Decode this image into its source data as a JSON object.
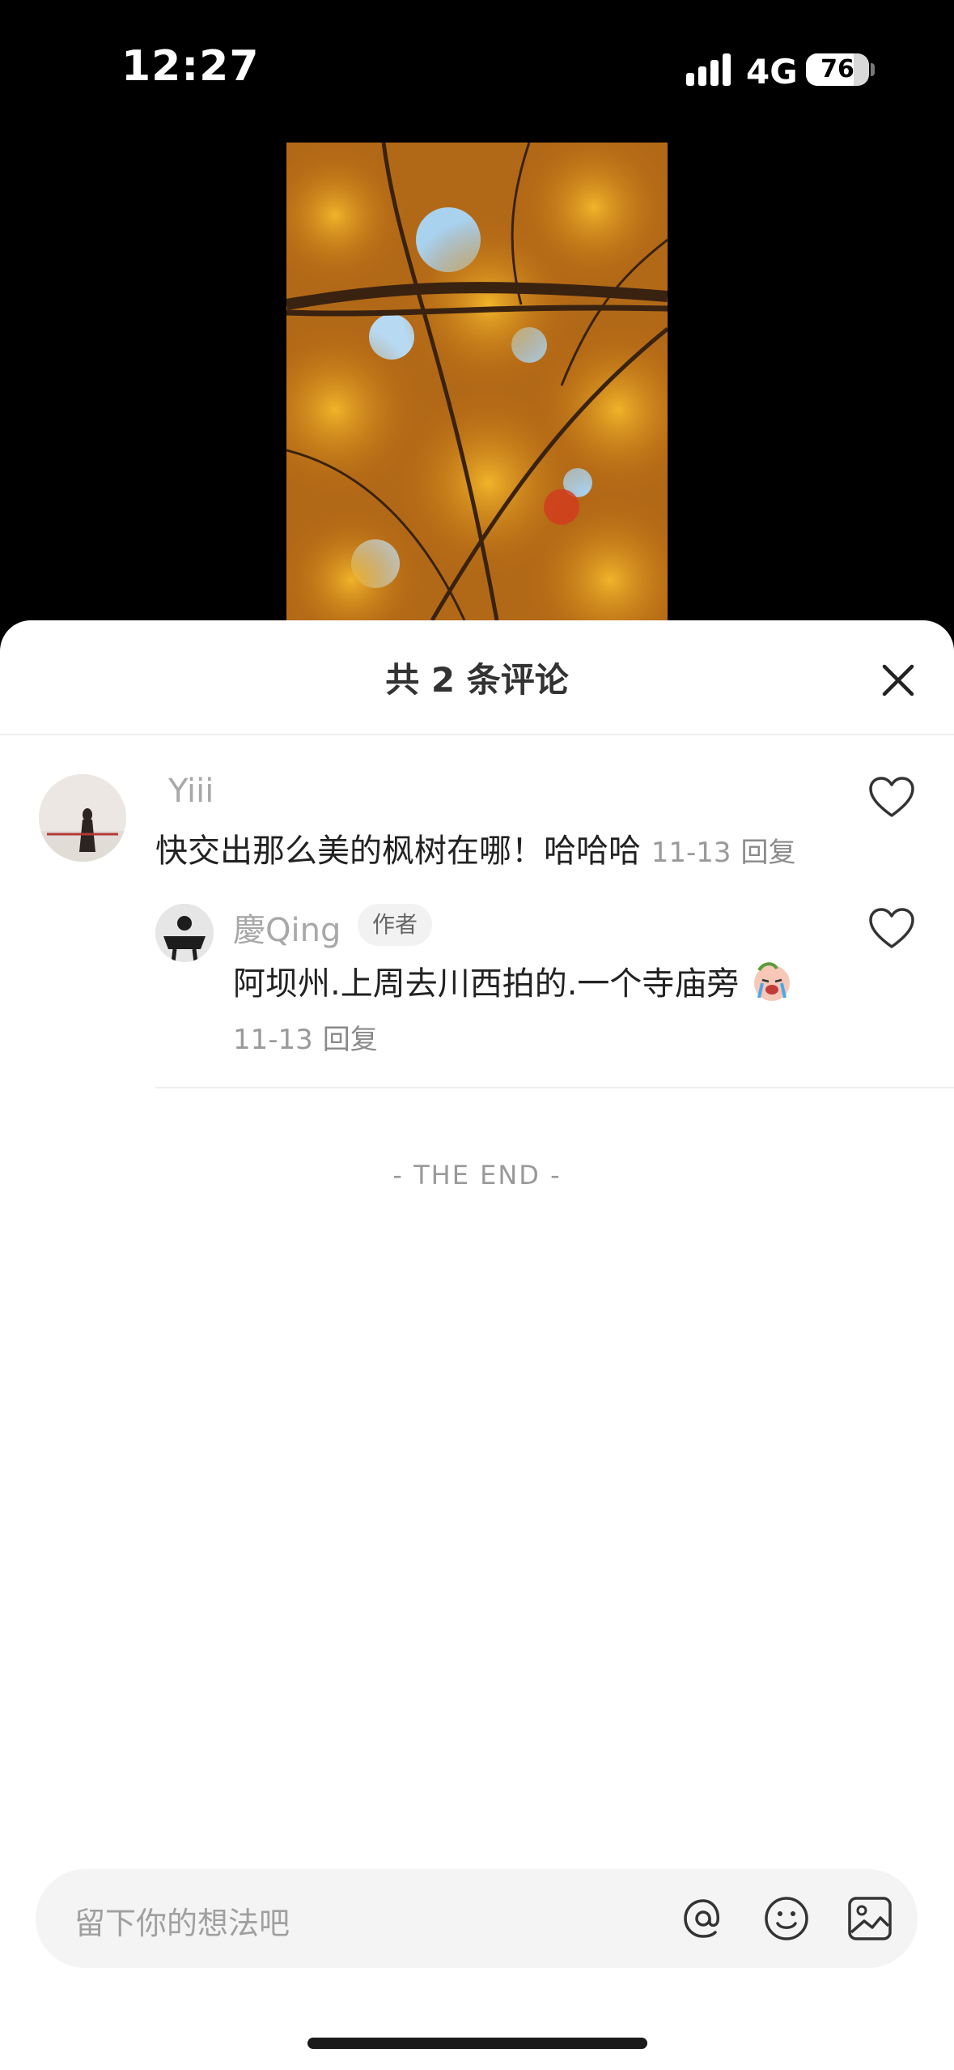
{
  "status_bar": {
    "time": "12:27",
    "network": "4G",
    "battery": "76",
    "battery_level": 0.76
  },
  "comments_panel": {
    "title": "共 2 条评论",
    "comments": [
      {
        "username": "Yiii",
        "text": "快交出那么美的枫树在哪！哈哈哈",
        "date": "11-13",
        "reply_label": "回复"
      }
    ],
    "replies": [
      {
        "username": "慶Qing",
        "badge": "作者",
        "text": "阿坝州.上周去川西拍的.一个寺庙旁",
        "date": "11-13",
        "reply_label": "回复"
      }
    ],
    "end_text": "- THE END -"
  },
  "input_bar": {
    "placeholder": "留下你的想法吧"
  },
  "icons": [
    "close-icon",
    "heart-icon",
    "at-icon",
    "emoji-icon",
    "image-icon"
  ]
}
